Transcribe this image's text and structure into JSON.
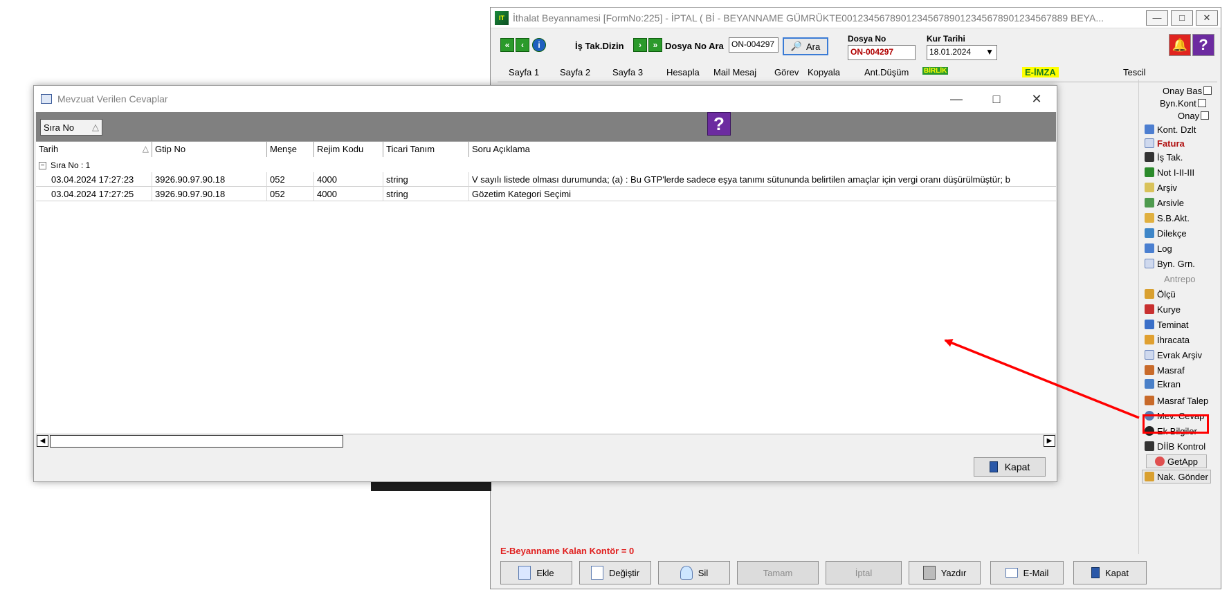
{
  "main": {
    "title": "İthalat Beyannamesi [FormNo:225] - İPTAL ( Bİ  - BEYANNAME GÜMRÜKTE001234567890123456789012345678901234567889   BEYA...",
    "toolbar": {
      "is_tak_dizin": "İş Tak.Dizin",
      "dosya_no_ara": "Dosya No Ara",
      "dosya_no_ara_value": "ON-004297",
      "ara_button": "Ara",
      "dosya_no_label": "Dosya No",
      "dosya_no_value": "ON-004297",
      "kur_tarihi_label": "Kur Tarihi",
      "kur_tarihi_value": "18.01.2024"
    },
    "tabs": [
      "Sayfa 1",
      "Sayfa 2",
      "Sayfa 3",
      "Hesapla",
      "Mail Mesaj",
      "Görev",
      "Kopyala",
      "Ant.Düşüm",
      "BİRLİK",
      "E-İMZA",
      "Tescil"
    ],
    "side_top": [
      "Onay Bas",
      "Byn.Kont",
      "Onay"
    ],
    "side_items": [
      {
        "label": "Kont.  Dzlt",
        "icon": "kont-icon"
      },
      {
        "label": "Fatura",
        "icon": "fatura-icon"
      },
      {
        "label": "İş Tak.",
        "icon": "is-tak-icon"
      },
      {
        "label": "Not I-II-III",
        "icon": "not-icon"
      },
      {
        "label": "Arşiv",
        "icon": "arsiv-icon"
      },
      {
        "label": "Arsivle",
        "icon": "arsivle-icon"
      },
      {
        "label": "S.B.Akt.",
        "icon": "sb-akt-icon"
      },
      {
        "label": "Dilekçe",
        "icon": "dilekce-icon"
      },
      {
        "label": "Log",
        "icon": "log-icon"
      },
      {
        "label": "Byn. Grn.",
        "icon": "byn-grn-icon"
      },
      {
        "label": "Antrepo",
        "icon": "antrepo-icon"
      },
      {
        "label": "Ölçü",
        "icon": "olcu-icon"
      },
      {
        "label": "Kurye",
        "icon": "kurye-icon"
      },
      {
        "label": "Teminat",
        "icon": "teminat-icon"
      },
      {
        "label": "İhracata",
        "icon": "ihracata-icon"
      },
      {
        "label": "Evrak Arşiv",
        "icon": "evrak-arsiv-icon"
      },
      {
        "label": "Masraf",
        "icon": "masraf-icon"
      },
      {
        "label": "Ekran",
        "icon": "ekran-icon"
      },
      {
        "label": "Masraf Talep",
        "icon": "masraf-talep-icon"
      },
      {
        "label": "Mev. Cevap",
        "icon": "mev-cevap-icon"
      },
      {
        "label": "Ek Bilgiler",
        "icon": "ek-bilgiler-icon"
      },
      {
        "label": "DİİB Kontrol",
        "icon": "diib-kontrol-icon"
      },
      {
        "label": "GetApp",
        "icon": "getapp-icon"
      },
      {
        "label": "Nak. Gönder",
        "icon": "nak-gonder-icon"
      }
    ],
    "kalan_kontor": "E-Beyanname Kalan Kontör = 0",
    "bottom_buttons": [
      "Ekle",
      "Değiştir",
      "Sil",
      "Tamam",
      "İptal",
      "Yazdır",
      "E-Mail",
      "Kapat"
    ]
  },
  "dialog": {
    "title": "Mevzuat Verilen Cevaplar",
    "group_chip": "Sıra No",
    "columns": [
      "Tarih",
      "Gtip No",
      "Menşe",
      "Rejim Kodu",
      "Ticari Tanım",
      "Soru Açıklama"
    ],
    "group_label": "Sıra No : 1",
    "rows": [
      [
        "03.04.2024 17:27:23",
        "3926.90.97.90.18",
        "052",
        "4000",
        "string",
        "V sayılı listede olması durumunda; (a) : Bu GTP'lerde sadece eşya tanımı sütununda belirtilen amaçlar için vergi oranı düşürülmüştür; b"
      ],
      [
        "03.04.2024 17:27:25",
        "3926.90.97.90.18",
        "052",
        "4000",
        "string",
        "Gözetim Kategori Seçimi"
      ]
    ],
    "close_button": "Kapat"
  },
  "colors": {
    "accent_red": "#ff0000",
    "kontor_red": "#e0201f",
    "group_bar": "#808080",
    "help_purple": "#6c2ba0"
  }
}
